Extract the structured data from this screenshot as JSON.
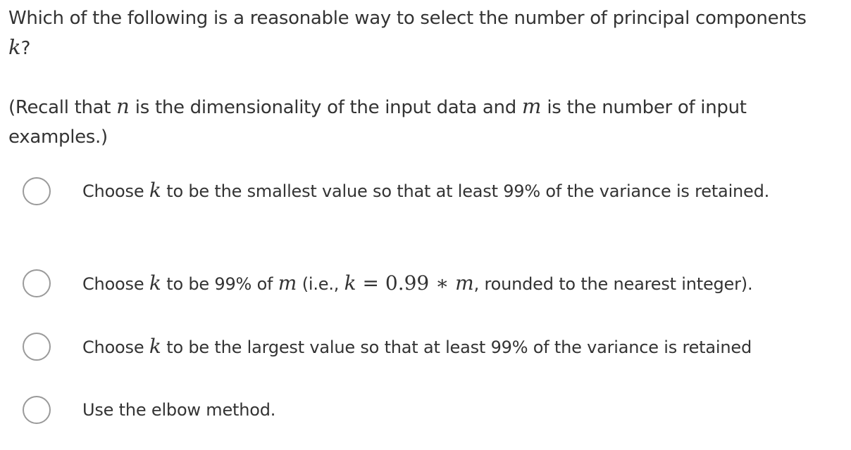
{
  "question": {
    "prefix": "Which of the following is a reasonable way to select the number of principal components",
    "variable": "k",
    "suffix": "?"
  },
  "recall": {
    "part1": "(Recall that ",
    "var_n": "n",
    "part2": " is the dimensionality of the input data and ",
    "var_m": "m",
    "part3": " is the number of input examples.)"
  },
  "options": [
    {
      "pre": "Choose ",
      "var": "k",
      "post": " to be the smallest value so that at least 99% of the variance is retained.",
      "selected": false
    },
    {
      "pre": "Choose ",
      "var": "k",
      "mid1": " to be 99% of ",
      "var2": "m",
      "mid2": " (i.e., ",
      "eq_lhs": "k",
      "eq_sign": " = ",
      "eq_num": "0.99",
      "eq_op": " ∗ ",
      "eq_rhs": "m",
      "post": ", rounded to the nearest integer).",
      "selected": false
    },
    {
      "pre": "Choose ",
      "var": "k",
      "post": " to be the largest value so that at least 99% of the variance is retained",
      "selected": false
    },
    {
      "text": "Use the elbow method.",
      "selected": false
    }
  ]
}
